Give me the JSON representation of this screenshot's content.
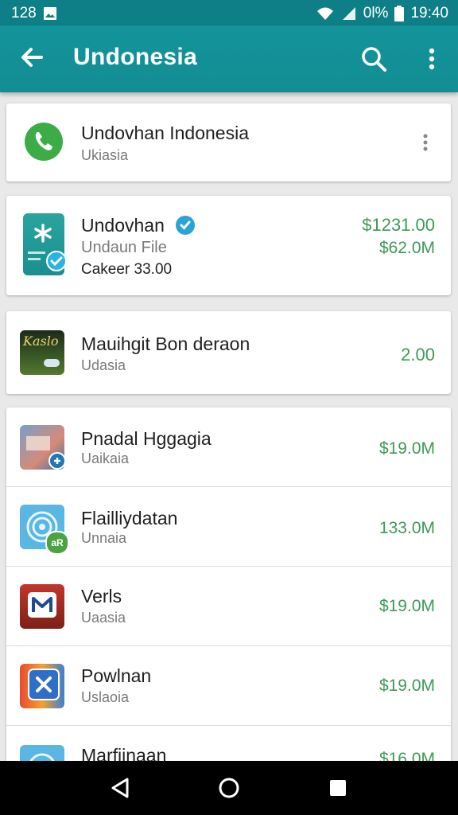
{
  "status": {
    "left_text": "128",
    "battery": "0l%",
    "time": "19:40"
  },
  "appbar": {
    "title": "Undonesia"
  },
  "header_card": {
    "name": "Undovhan Indonesia",
    "sub": "Ukiasia"
  },
  "featured": {
    "name": "Undovhan",
    "sub1": "Undaun File",
    "sub2": "Cakeer  33.00",
    "price1": "$1231.00",
    "price2": "$62.0M"
  },
  "third": {
    "name": "Mauihgit Bon deraon",
    "sub": "Udasia",
    "price": "2.00",
    "icon_text": "Kaslo"
  },
  "list": [
    {
      "name": "Pnadal Hggagia",
      "sub": "Uaikaia",
      "price": "$19.0M"
    },
    {
      "name": "Flailliydatan",
      "sub": "Unnaia",
      "price": "133.0M",
      "badge": "aR"
    },
    {
      "name": "Verls",
      "sub": "Uaasia",
      "price": "$19.0M"
    },
    {
      "name": "Powlnan",
      "sub": "Uslaoia",
      "price": "$19.0M"
    },
    {
      "name": "Marfiinaan",
      "sub": "",
      "price": "$16.0M"
    }
  ],
  "colors": {
    "toolbar": "#13949a",
    "price_green": "#3e9a57"
  }
}
